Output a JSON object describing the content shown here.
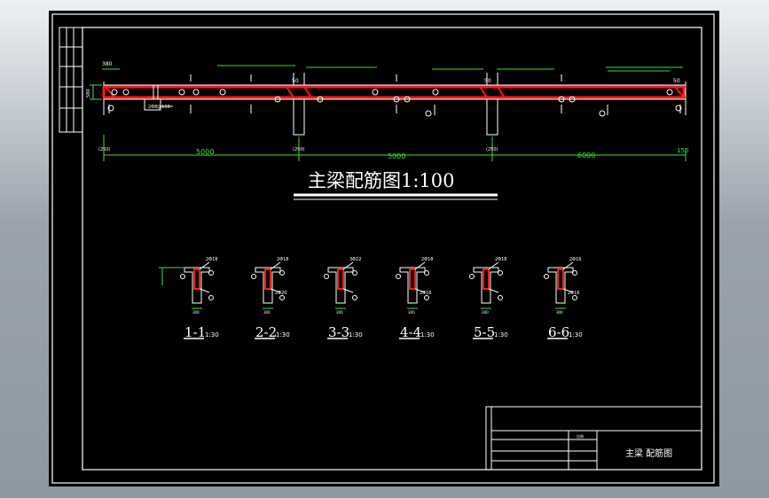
{
  "main_drawing": {
    "title": "主梁配筋图1:100",
    "span_dims": [
      "5000",
      "5000",
      "6000"
    ],
    "end_dim": "150",
    "beam_height": "580",
    "col_width": "380",
    "support_labels": [
      "50",
      "50",
      "50"
    ],
    "callout": "2Φ8@150",
    "bottom_axis_labels": [
      "(250)",
      "(250)",
      "(250)"
    ]
  },
  "sections": [
    {
      "label": "1-1",
      "scale": "1:30",
      "top_bar": "2Φ18",
      "bottom_bar": "",
      "width": "300"
    },
    {
      "label": "2-2",
      "scale": "1:30",
      "top_bar": "2Φ18",
      "bottom_bar": "2Φ20",
      "width": "300"
    },
    {
      "label": "3-3",
      "scale": "1:30",
      "top_bar": "3Φ22",
      "bottom_bar": "",
      "width": "300"
    },
    {
      "label": "4-4",
      "scale": "1:30",
      "top_bar": "2Φ18",
      "bottom_bar": "2Φ16",
      "width": "300"
    },
    {
      "label": "5-5",
      "scale": "1:30",
      "top_bar": "2Φ18",
      "bottom_bar": "",
      "width": "300"
    },
    {
      "label": "6-6",
      "scale": "1:30",
      "top_bar": "2Φ16",
      "bottom_bar": "2Φ16",
      "width": "300"
    }
  ],
  "title_block": {
    "drawing_name": "主梁 配筋图",
    "small_label": "比例"
  },
  "colors": {
    "background": "#000000",
    "lines": "#ffffff",
    "dims": "#33e633",
    "rebar": "#ff1a1a"
  }
}
